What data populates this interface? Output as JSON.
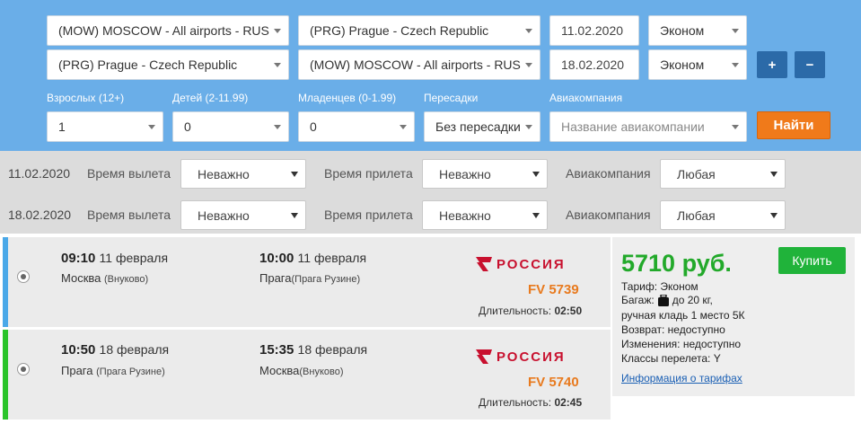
{
  "search": {
    "row1": {
      "from": "(MOW) MOSCOW - All airports - RUS",
      "to": "(PRG) Prague - Czech Republic",
      "date": "11.02.2020",
      "class": "Эконом"
    },
    "row2": {
      "from": "(PRG) Prague - Czech Republic",
      "to": "(MOW) MOSCOW - All airports - RUS",
      "date": "18.02.2020",
      "class": "Эконом"
    },
    "plus_label": "+",
    "minus_label": "−",
    "labels": {
      "adults": "Взрослых (12+)",
      "children": "Детей (2-11.99)",
      "infants": "Младенцев (0-1.99)",
      "transfers": "Пересадки",
      "airline": "Авиакомпания"
    },
    "values": {
      "adults": "1",
      "children": "0",
      "infants": "0",
      "transfers": "Без пересадки"
    },
    "airline_placeholder": "Название авиакомпании",
    "find_label": "Найти"
  },
  "filters": [
    {
      "date": "11.02.2020",
      "dep_label": "Время вылета",
      "dep_value": "Неважно",
      "arr_label": "Время прилета",
      "arr_value": "Неважно",
      "airline_label": "Авиакомпания",
      "airline_value": "Любая"
    },
    {
      "date": "18.02.2020",
      "dep_label": "Время вылета",
      "dep_value": "Неважно",
      "arr_label": "Время прилета",
      "arr_value": "Неважно",
      "airline_label": "Авиакомпания",
      "airline_value": "Любая"
    }
  ],
  "segments": [
    {
      "dep_time": "09:10",
      "dep_date": "11 февраля",
      "dep_city": "Москва",
      "dep_airport": "(Внуково)",
      "arr_time": "10:00",
      "arr_date": "11 февраля",
      "arr_city": "Прага",
      "arr_airport": "(Прага Рузине)",
      "airline": "РОССИЯ",
      "flight": "FV 5739",
      "duration_label": "Длительность:",
      "duration": "02:50",
      "bar_color": "#4aa8e8"
    },
    {
      "dep_time": "10:50",
      "dep_date": "18 февраля",
      "dep_city": "Прага",
      "dep_airport": "(Прага Рузине)",
      "arr_time": "15:35",
      "arr_date": "18 февраля",
      "arr_city": "Москва",
      "arr_airport": "(Внуково)",
      "airline": "РОССИЯ",
      "flight": "FV 5740",
      "duration_label": "Длительность:",
      "duration": "02:45",
      "bar_color": "#2bc42b"
    }
  ],
  "offer": {
    "price": "5710 руб.",
    "buy_label": "Купить",
    "tariff": "Тариф: Эконом",
    "baggage_prefix": "Багаж:",
    "baggage_value": "до 20 кг,",
    "hand_luggage": "ручная кладь 1 место 5К",
    "refund": "Возврат: недоступно",
    "changes": "Изменения: недоступно",
    "classes": "Классы перелета: Y",
    "tariff_info_link": "Информация о тарифах"
  }
}
